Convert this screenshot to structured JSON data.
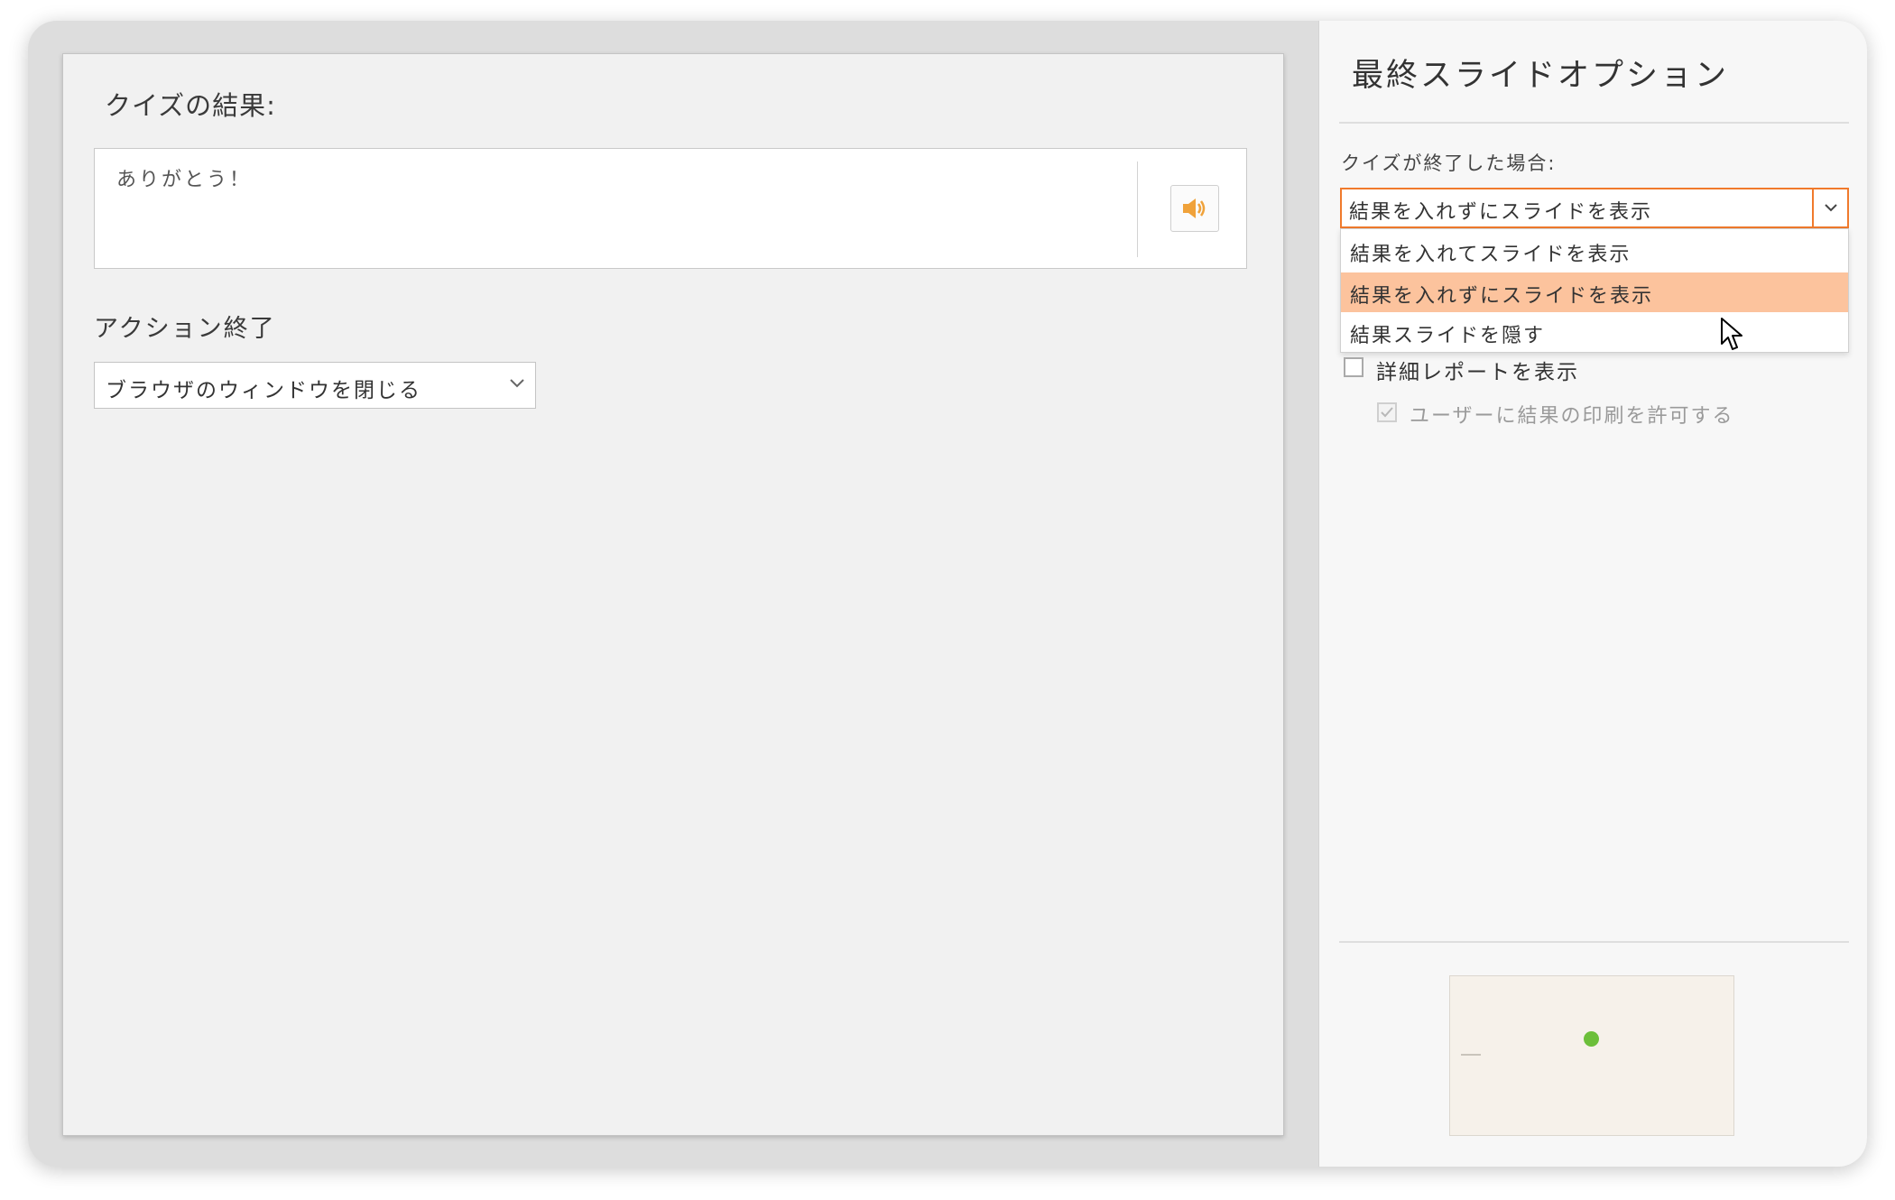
{
  "editor": {
    "quiz_result_title": "クイズの結果:",
    "message_text": "ありがとう！",
    "audio_icon": "speaker-icon",
    "action_label": "アクション終了",
    "action_select_value": "ブラウザのウィンドウを閉じる"
  },
  "panel": {
    "title": "最終スライドオプション",
    "ended_label": "クイズが終了した場合:",
    "ended_select_value": "結果を入れずにスライドを表示",
    "dropdown_options": [
      "結果を入れてスライドを表示",
      "結果を入れずにスライドを表示",
      "結果スライドを隠す"
    ],
    "highlighted_option_index": 1,
    "detail_report_label": "詳細レポートを表示",
    "detail_report_checked": false,
    "allow_print_label": "ユーザーに結果の印刷を許可する",
    "allow_print_checked": true,
    "allow_print_disabled": true
  },
  "colors": {
    "accent": "#f07a2c",
    "highlight": "#fcc39d",
    "audio_icon": "#f0a23a",
    "thumb_check": "#6cbf3a"
  }
}
